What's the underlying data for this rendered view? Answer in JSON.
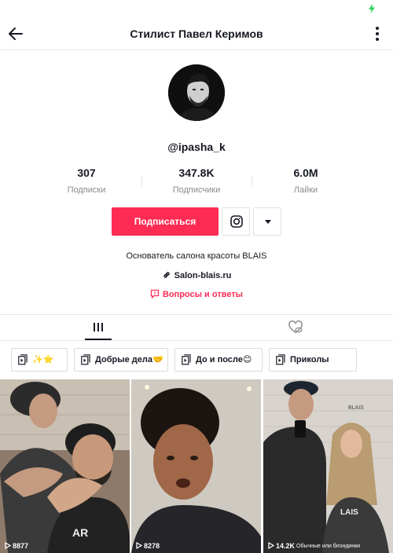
{
  "header": {
    "title": "Стилист Павел Керимов",
    "back_icon": "arrow-left-icon",
    "more_icon": "vertical-dots-icon"
  },
  "status_bar": {
    "battery_icon": "battery-charging-icon",
    "battery_color": "#2bd158"
  },
  "profile": {
    "username": "@ipasha_k",
    "stats": [
      {
        "value": "307",
        "label": "Подписки"
      },
      {
        "value": "347.8K",
        "label": "Подписчики"
      },
      {
        "value": "6.0M",
        "label": "Лайки"
      }
    ],
    "follow_label": "Подписаться",
    "follow_color": "#fe2c55",
    "instagram_icon": "instagram-icon",
    "dropdown_icon": "caret-down-icon",
    "bio": "Основатель салона красоты BLAIS",
    "link": "Salon-blais.ru",
    "qa_label": "Вопросы и ответы"
  },
  "tabs": [
    {
      "icon": "grid-lines-icon",
      "active": true
    },
    {
      "icon": "liked-heart-eye-icon",
      "active": false
    }
  ],
  "playlists": [
    {
      "label": "✨⭐"
    },
    {
      "label": "Добрые дела🤝"
    },
    {
      "label": "До и после😊"
    },
    {
      "label": "Приколы"
    }
  ],
  "videos": [
    {
      "views": "8877",
      "caption": ""
    },
    {
      "views": "8278",
      "caption": ""
    },
    {
      "views": "14.2K",
      "caption": "Обычные или блондинки"
    }
  ]
}
